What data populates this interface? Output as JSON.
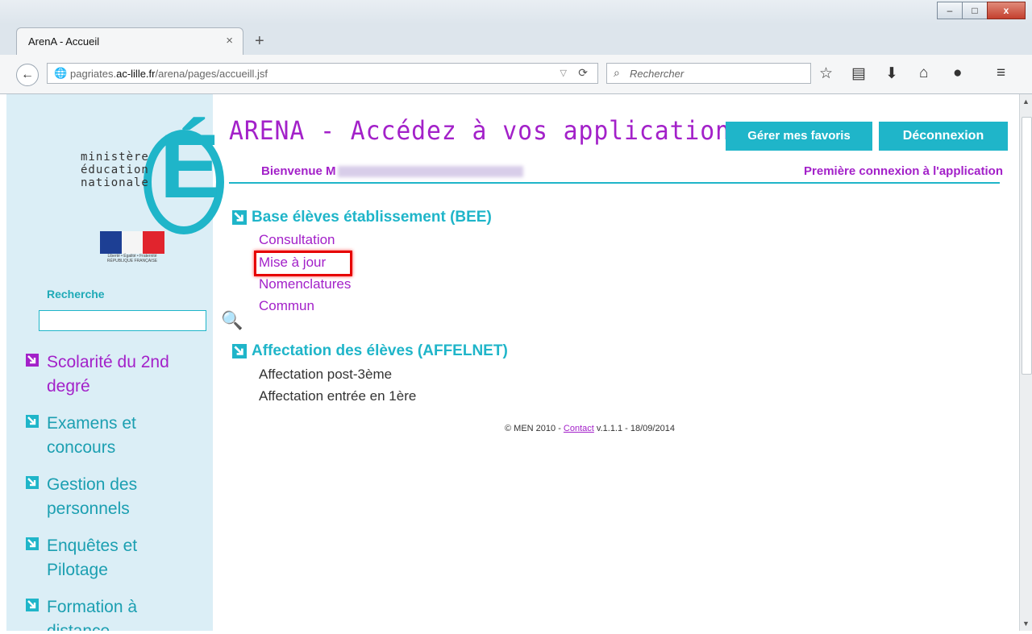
{
  "window": {
    "minimize": "–",
    "maximize": "□",
    "close": "x"
  },
  "tab": {
    "title": "ArenA - Accueil",
    "close": "×",
    "new_tab": "+"
  },
  "nav": {
    "back": "←",
    "url_host_prefix": "pagriates.",
    "url_domain": "ac-lille.fr",
    "url_path": "/arena/pages/accueill.jsf",
    "search_placeholder": "Rechercher"
  },
  "toolbar_icons": [
    "star-icon",
    "reading-list-icon",
    "download-icon",
    "home-icon",
    "chat-icon",
    "menu-icon"
  ],
  "sidebar": {
    "logo_text": "ministère\néducation\nnationale",
    "logo_letter": "É",
    "flag_caption": "Liberté • Égalité • Fraternité RÉPUBLIQUE FRANÇAISE",
    "search_label": "Recherche",
    "search_value": "",
    "items": [
      {
        "label": "Scolarité du 2nd degré"
      },
      {
        "label": "Examens et concours"
      },
      {
        "label": "Gestion des personnels"
      },
      {
        "label": "Enquêtes et Pilotage"
      },
      {
        "label": "Formation à distance"
      }
    ]
  },
  "header": {
    "title": "ARENA - Accédez à vos applications",
    "favorites_button": "Gérer mes favoris",
    "logout_button": "Déconnexion",
    "welcome": "Bienvenue M",
    "first_connection": "Première connexion à l'application"
  },
  "sections": [
    {
      "title": "Base élèves établissement (BEE)",
      "links": [
        "Consultation",
        "Mise à jour",
        "Nomenclatures",
        "Commun"
      ]
    },
    {
      "title": "Affectation des élèves (AFFELNET)",
      "links": [
        "Affectation post-3ème",
        "Affectation entrée en 1ère"
      ]
    }
  ],
  "footer": {
    "prefix": "© MEN 2010 - ",
    "contact": "Contact",
    "suffix": " v.1.1.1 - 18/09/2014"
  },
  "colors": {
    "accent": "#1fb5c9",
    "purple": "#a321c9",
    "sidebar_bg": "#dbeef6",
    "highlight": "#e60000"
  }
}
